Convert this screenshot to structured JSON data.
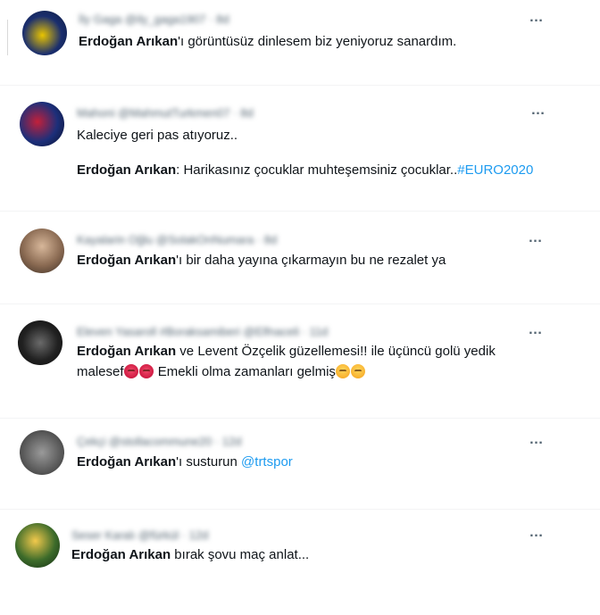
{
  "tweets": [
    {
      "header": "İly Gaga @ily_gaga1907 · 8d",
      "lines": [
        {
          "bold": "Erdoğan Arıkan",
          "rest": "'ı görüntüsüz dinlesem biz yeniyoruz sanardım."
        }
      ]
    },
    {
      "header": "Mahoni @MahmutTurkmen07 · 8d",
      "line1": "Kaleciye geri pas atıyoruz..",
      "lines": [
        {
          "bold": "Erdoğan Arıkan",
          "rest": ": Harikasınız çocuklar muhteşemsiniz çocuklar..",
          "link": "#EURO2020"
        }
      ]
    },
    {
      "header": "Kayalarin Oğlu @SolakOnNumara · 8d",
      "lines": [
        {
          "bold": "Erdoğan Arıkan",
          "rest": "'ı bir daha yayına çıkarmayın bu ne rezalet ya"
        }
      ]
    },
    {
      "header": "Eleven Yasaroll #Boraksamiberi @Elfnaceli · 11d",
      "lines": [
        {
          "bold": "Erdoğan Arıkan",
          "rest": " ve Levent Özçelik güzellemesi!! ile üçüncü golü yedik"
        },
        {
          "rest": "malesef",
          "rest2": " Emekli olma zamanları gelmiş"
        }
      ],
      "emoji_angry": "angry-face",
      "emoji_think": "thinking-face"
    },
    {
      "header": "Çekçi @stollacommune20 · 12d",
      "lines": [
        {
          "bold": "Erdoğan Arıkan",
          "rest": "'ı susturun ",
          "link": "@trtspor"
        }
      ]
    },
    {
      "header": "Seser Karalı @fürkül · 12d",
      "lines": [
        {
          "bold": "Erdoğan Arıkan",
          "rest": " bırak şovu maç anlat..."
        }
      ]
    }
  ],
  "more_icon": "…",
  "colors": {
    "link": "#1d9bf0",
    "text": "#0f1419",
    "muted": "#536471"
  }
}
